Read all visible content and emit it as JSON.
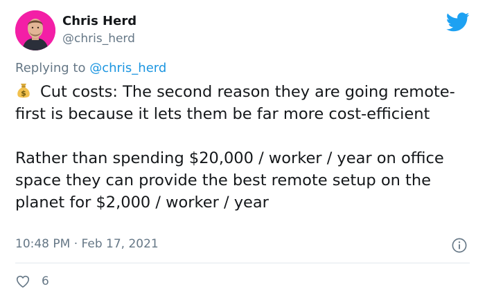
{
  "tweet": {
    "author_name": "Chris Herd",
    "author_handle": "@chris_herd",
    "replying_prefix": "Replying to ",
    "replying_handle": "@chris_herd",
    "emoji_icon": "money-bag-icon",
    "paragraph_1": "Cut costs: The second reason they are going remote-first is because it lets them be far more cost-efficient",
    "paragraph_2": "Rather than spending $20,000 / worker / year on office space they can provide the best remote setup on the planet for $2,000 / worker / year",
    "time": "10:48 PM",
    "separator": "·",
    "date": "Feb 17, 2021",
    "like_count": "6"
  },
  "colors": {
    "avatar_bg": "#f31fa6",
    "twitter_blue": "#1da1f2",
    "link_blue": "#1b95e0",
    "muted_gray": "#657786",
    "divider": "#e1e8ed"
  }
}
